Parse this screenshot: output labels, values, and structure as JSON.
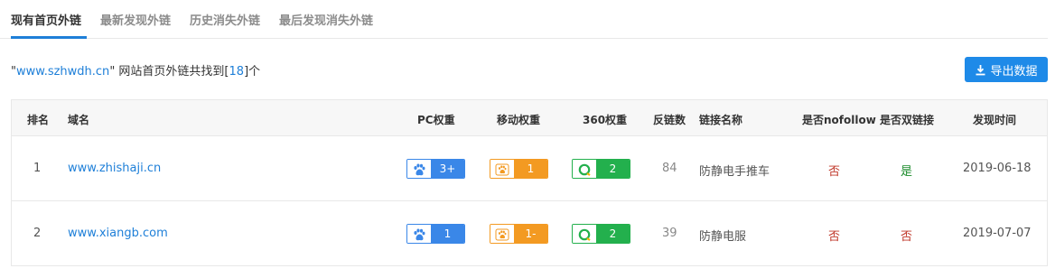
{
  "tabs": [
    {
      "label": "现有首页外链",
      "active": true
    },
    {
      "label": "最新发现外链",
      "active": false
    },
    {
      "label": "历史消失外链",
      "active": false
    },
    {
      "label": "最后发现消失外链",
      "active": false
    }
  ],
  "summary": {
    "quote_open": "\"",
    "site": "www.szhwdh.cn",
    "quote_close": "\"",
    "text_mid": " 网站首页外链共找到[",
    "count": "18",
    "text_end": "]个"
  },
  "export_button": {
    "label": "导出数据",
    "icon": "download-icon"
  },
  "table": {
    "headers": {
      "rank": "排名",
      "domain": "域名",
      "pc_weight": "PC权重",
      "mobile_weight": "移动权重",
      "so_weight": "360权重",
      "backlinks": "反链数",
      "link_name": "链接名称",
      "nofollow": "是否nofollow",
      "double_link": "是否双链接",
      "found_time": "发现时间"
    },
    "rows": [
      {
        "rank": "1",
        "domain": "www.zhishaji.cn",
        "pc_weight": "3+",
        "mobile_weight": "1",
        "so_weight": "2",
        "backlinks": "84",
        "link_name": "防静电手推车",
        "nofollow": "否",
        "double_link": "是",
        "found_time": "2019-06-18"
      },
      {
        "rank": "2",
        "domain": "www.xiangb.com",
        "pc_weight": "1",
        "mobile_weight": "1-",
        "so_weight": "2",
        "backlinks": "39",
        "link_name": "防静电服",
        "nofollow": "否",
        "double_link": "否",
        "found_time": "2019-07-07"
      }
    ]
  },
  "colors": {
    "accent": "#1e7fd8",
    "baidu": "#3a87e8",
    "mobile": "#f39a22",
    "so360": "#23b04d",
    "no": "#c0392b",
    "yes": "#1a8a2a"
  }
}
